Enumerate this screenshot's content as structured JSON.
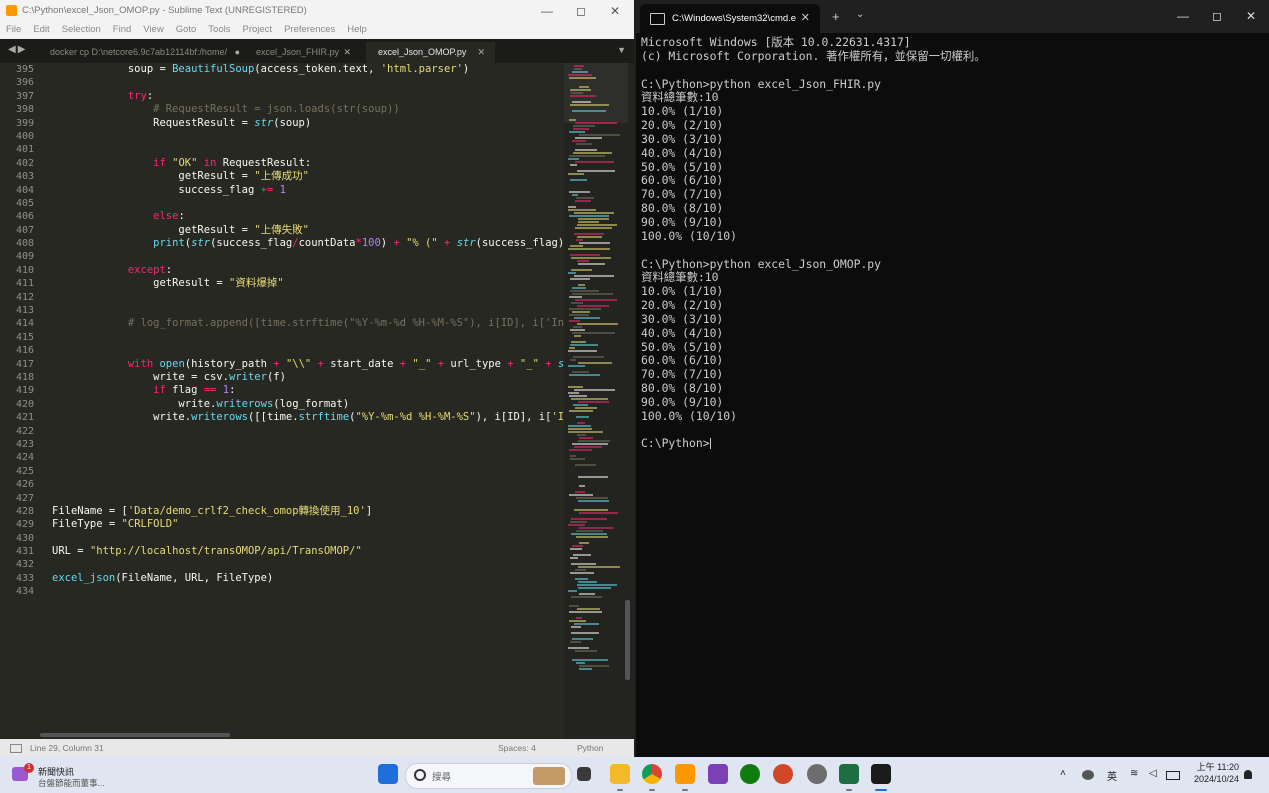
{
  "sublime": {
    "title": "C:\\Python\\excel_Json_OMOP.py - Sublime Text (UNREGISTERED)",
    "menu": [
      "File",
      "Edit",
      "Selection",
      "Find",
      "View",
      "Goto",
      "Tools",
      "Project",
      "Preferences",
      "Help"
    ],
    "tabs": [
      {
        "label": "docker cp D:\\netcore6.9c7ab12114bf:/home/",
        "close": "●"
      },
      {
        "label": "excel_Json_FHIR.py",
        "close": "✕"
      },
      {
        "label": "excel_Json_OMOP.py",
        "close": "✕"
      }
    ],
    "lines": [
      {
        "n": "395",
        "t": [
          [
            "",
            "            soup = "
          ],
          [
            "fn",
            "BeautifulSoup"
          ],
          [
            "",
            "(access_token.text, "
          ],
          [
            "st",
            "'html.parser'"
          ],
          [
            "",
            ")"
          ]
        ]
      },
      {
        "n": "396",
        "t": []
      },
      {
        "n": "397",
        "t": [
          [
            "",
            "            "
          ],
          [
            "kw",
            "try"
          ],
          [
            "",
            ":"
          ]
        ]
      },
      {
        "n": "398",
        "t": [
          [
            "cm",
            "                # RequestResult = json.loads(str(soup))"
          ]
        ]
      },
      {
        "n": "399",
        "t": [
          [
            "",
            "                RequestResult = "
          ],
          [
            "it",
            "str"
          ],
          [
            "",
            "(soup)"
          ]
        ]
      },
      {
        "n": "400",
        "t": []
      },
      {
        "n": "401",
        "t": []
      },
      {
        "n": "402",
        "t": [
          [
            "",
            "                "
          ],
          [
            "kw",
            "if"
          ],
          [
            "",
            " "
          ],
          [
            "st",
            "\"OK\""
          ],
          [
            "",
            " "
          ],
          [
            "kw",
            "in"
          ],
          [
            "",
            " RequestResult:"
          ]
        ]
      },
      {
        "n": "403",
        "t": [
          [
            "",
            "                    getResult = "
          ],
          [
            "st",
            "\"上傳成功\""
          ]
        ]
      },
      {
        "n": "404",
        "t": [
          [
            "",
            "                    success_flag "
          ],
          [
            "kw",
            "+="
          ],
          [
            "",
            " "
          ],
          [
            "nm",
            "1"
          ]
        ]
      },
      {
        "n": "405",
        "t": []
      },
      {
        "n": "406",
        "t": [
          [
            "",
            "                "
          ],
          [
            "kw",
            "else"
          ],
          [
            "",
            ":"
          ]
        ]
      },
      {
        "n": "407",
        "t": [
          [
            "",
            "                    getResult = "
          ],
          [
            "st",
            "\"上傳失敗\""
          ]
        ]
      },
      {
        "n": "408",
        "t": [
          [
            "",
            "                "
          ],
          [
            "fn",
            "print"
          ],
          [
            "",
            "("
          ],
          [
            "it",
            "str"
          ],
          [
            "",
            "(success_flag"
          ],
          [
            "kw",
            "/"
          ],
          [
            "",
            "countData"
          ],
          [
            "kw",
            "*"
          ],
          [
            "nm",
            "100"
          ],
          [
            "",
            ") "
          ],
          [
            "kw",
            "+"
          ],
          [
            "",
            " "
          ],
          [
            "st",
            "\"% (\""
          ],
          [
            "",
            " "
          ],
          [
            "kw",
            "+"
          ],
          [
            "",
            " "
          ],
          [
            "it",
            "str"
          ],
          [
            "",
            "(success_flag) "
          ],
          [
            "kw",
            "+"
          ]
        ]
      },
      {
        "n": "409",
        "t": []
      },
      {
        "n": "410",
        "t": [
          [
            "",
            "            "
          ],
          [
            "kw",
            "except"
          ],
          [
            "",
            ":"
          ]
        ]
      },
      {
        "n": "411",
        "t": [
          [
            "",
            "                getResult = "
          ],
          [
            "st",
            "\"資料爆掉\""
          ]
        ]
      },
      {
        "n": "412",
        "t": []
      },
      {
        "n": "413",
        "t": []
      },
      {
        "n": "414",
        "t": [
          [
            "cm",
            "            # log_format.append([time.strftime(\"%Y-%m-%d %H-%M-%S\"), i[ID], i['Inde"
          ]
        ]
      },
      {
        "n": "415",
        "t": []
      },
      {
        "n": "416",
        "t": []
      },
      {
        "n": "417",
        "t": [
          [
            "",
            "            "
          ],
          [
            "kw",
            "with"
          ],
          [
            "",
            " "
          ],
          [
            "fn",
            "open"
          ],
          [
            "",
            "(history_path "
          ],
          [
            "kw",
            "+"
          ],
          [
            "",
            " "
          ],
          [
            "st",
            "\"\\\\\""
          ],
          [
            "",
            " "
          ],
          [
            "kw",
            "+"
          ],
          [
            "",
            " start_date "
          ],
          [
            "kw",
            "+"
          ],
          [
            "",
            " "
          ],
          [
            "st",
            "\"_\""
          ],
          [
            "",
            " "
          ],
          [
            "kw",
            "+"
          ],
          [
            "",
            " url_type "
          ],
          [
            "kw",
            "+"
          ],
          [
            "",
            " "
          ],
          [
            "st",
            "\"_\""
          ],
          [
            "",
            " "
          ],
          [
            "kw",
            "+"
          ],
          [
            "",
            " "
          ],
          [
            "it",
            "str"
          ],
          [
            "",
            "("
          ]
        ]
      },
      {
        "n": "418",
        "t": [
          [
            "",
            "                write = csv."
          ],
          [
            "fn",
            "writer"
          ],
          [
            "",
            "(f)"
          ]
        ]
      },
      {
        "n": "419",
        "t": [
          [
            "",
            "                "
          ],
          [
            "kw",
            "if"
          ],
          [
            "",
            " flag "
          ],
          [
            "kw",
            "=="
          ],
          [
            "",
            " "
          ],
          [
            "nm",
            "1"
          ],
          [
            "",
            ":"
          ]
        ]
      },
      {
        "n": "420",
        "t": [
          [
            "",
            "                    write."
          ],
          [
            "fn",
            "writerows"
          ],
          [
            "",
            "(log_format)"
          ]
        ]
      },
      {
        "n": "421",
        "t": [
          [
            "",
            "                write."
          ],
          [
            "fn",
            "writerows"
          ],
          [
            "",
            "([[time."
          ],
          [
            "fn",
            "strftime"
          ],
          [
            "",
            "("
          ],
          [
            "st",
            "\"%Y-%m-%d %H-%M-%S\""
          ],
          [
            "",
            "), i[ID], i["
          ],
          [
            "st",
            "'Inde"
          ]
        ]
      },
      {
        "n": "422",
        "t": []
      },
      {
        "n": "423",
        "t": []
      },
      {
        "n": "424",
        "t": []
      },
      {
        "n": "425",
        "t": []
      },
      {
        "n": "426",
        "t": []
      },
      {
        "n": "427",
        "t": []
      },
      {
        "n": "428",
        "t": [
          [
            "",
            "FileName = ["
          ],
          [
            "st",
            "'Data/demo_crlf2_check_omop轉換使用_10'"
          ],
          [
            "",
            "]"
          ]
        ]
      },
      {
        "n": "429",
        "t": [
          [
            "",
            "FileType = "
          ],
          [
            "st",
            "\"CRLFOLD\""
          ]
        ]
      },
      {
        "n": "430",
        "t": []
      },
      {
        "n": "431",
        "t": [
          [
            "",
            "URL = "
          ],
          [
            "st",
            "\"http://localhost/transOMOP/api/TransOMOP/\""
          ]
        ]
      },
      {
        "n": "432",
        "t": []
      },
      {
        "n": "433",
        "t": [
          [
            "fn",
            "excel_json"
          ],
          [
            "",
            "(FileName, URL, FileType)"
          ]
        ]
      },
      {
        "n": "434",
        "t": []
      }
    ],
    "status": {
      "position": "Line 29, Column 31",
      "spaces": "Spaces: 4",
      "syntax": "Python"
    }
  },
  "cmd": {
    "tab_title": "C:\\Windows\\System32\\cmd.e",
    "lines": [
      "Microsoft Windows [版本 10.0.22631.4317]",
      "(c) Microsoft Corporation. 著作權所有，並保留一切權利。",
      "",
      "C:\\Python>python excel_Json_FHIR.py",
      "資料總筆數:10",
      "10.0% (1/10)",
      "20.0% (2/10)",
      "30.0% (3/10)",
      "40.0% (4/10)",
      "50.0% (5/10)",
      "60.0% (6/10)",
      "70.0% (7/10)",
      "80.0% (8/10)",
      "90.0% (9/10)",
      "100.0% (10/10)",
      "",
      "C:\\Python>python excel_Json_OMOP.py",
      "資料總筆數:10",
      "10.0% (1/10)",
      "20.0% (2/10)",
      "30.0% (3/10)",
      "40.0% (4/10)",
      "50.0% (5/10)",
      "60.0% (6/10)",
      "70.0% (7/10)",
      "80.0% (8/10)",
      "90.0% (9/10)",
      "100.0% (10/10)",
      "",
      "C:\\Python>"
    ]
  },
  "taskbar": {
    "news_badge": "1",
    "news_title": "新聞快訊",
    "news_sub": "台盤節能而董事...",
    "search_placeholder": "搜尋",
    "ime": "英",
    "time": "上午 11:20",
    "date": "2024/10/24"
  },
  "colors": {
    "editor_bg": "#272822",
    "keyword": "#f92672",
    "string": "#e6db74",
    "function": "#66d9ef",
    "number": "#ae81ff",
    "comment": "#75715e",
    "terminal_bg": "#0c0c0c",
    "taskbar_bg": "#dfe5f1"
  }
}
